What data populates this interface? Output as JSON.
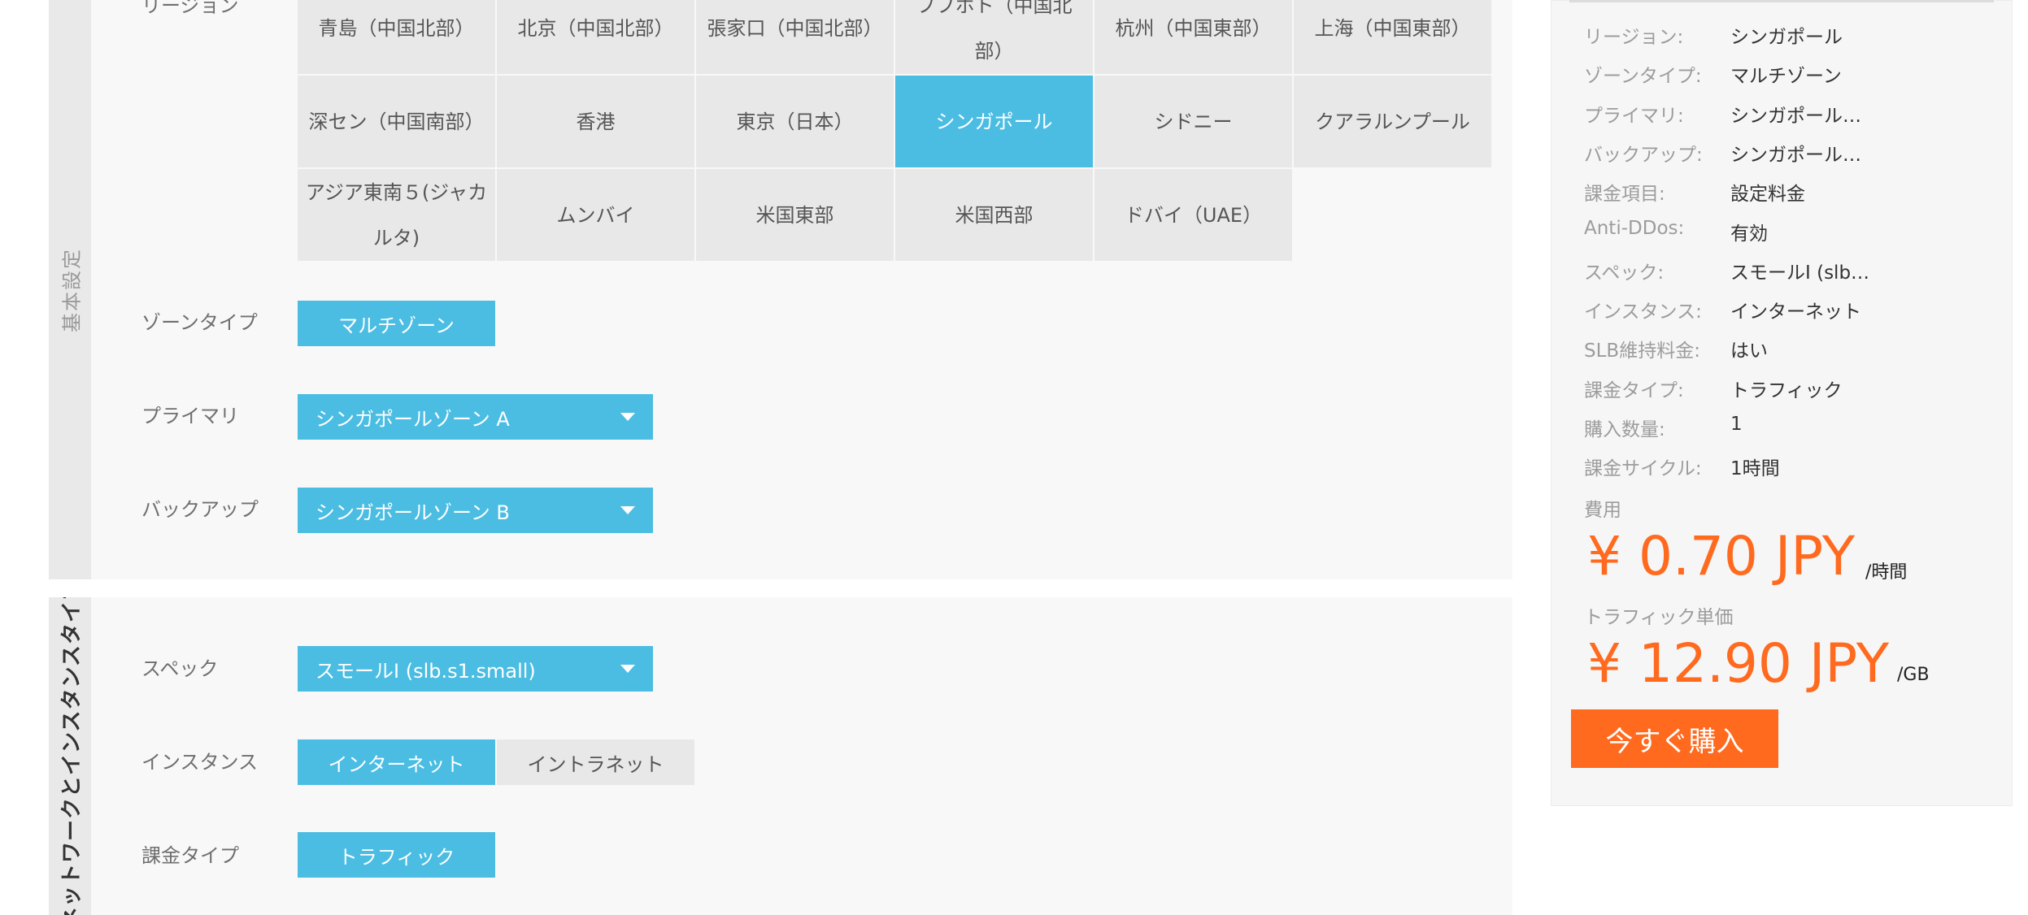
{
  "basic_settings": {
    "section_title": "基本設定",
    "region_label": "リージョン",
    "regions": [
      "青島（中国北部）",
      "北京（中国北部）",
      "張家口（中国北部）",
      "フフホト（中国北部）",
      "杭州（中国東部）",
      "上海（中国東部）",
      "深セン（中国南部）",
      "香港",
      "東京（日本）",
      "シンガポール",
      "シドニー",
      "クアラルンプール",
      "アジア東南５(ジャカルタ)",
      "ムンバイ",
      "米国東部",
      "米国西部",
      "ドバイ（UAE）"
    ],
    "selected_region": "シンガポール",
    "zone_type_label": "ゾーンタイプ",
    "zone_type_value": "マルチゾーン",
    "primary_label": "プライマリ",
    "primary_value": "シンガポールゾーン A",
    "backup_label": "バックアップ",
    "backup_value": "シンガポールゾーン B"
  },
  "network_instance": {
    "section_title": "ネットワークとインスタンスタイプ",
    "spec_label": "スペック",
    "spec_value": "スモールI (slb.s1.small)",
    "instance_label": "インスタンス",
    "instance_options": [
      "インターネット",
      "イントラネット"
    ],
    "instance_selected": "インターネット",
    "billing_type_label": "課金タイプ",
    "billing_type_value": "トラフィック"
  },
  "summary": {
    "rows": [
      {
        "label": "リージョン:",
        "value": "シンガポール"
      },
      {
        "label": "ゾーンタイプ:",
        "value": "マルチゾーン"
      },
      {
        "label": "プライマリ:",
        "value": "シンガポール…"
      },
      {
        "label": "バックアップ:",
        "value": "シンガポール…"
      },
      {
        "label": "課金項目:",
        "value": "設定料金"
      },
      {
        "label": "Anti-DDos:",
        "value": "有効"
      },
      {
        "label": "スペック:",
        "value": "スモールI (slb…"
      },
      {
        "label": "インスタンス:",
        "value": "インターネット"
      },
      {
        "label": "SLB維持料金:",
        "value": "はい"
      },
      {
        "label": "課金タイプ:",
        "value": "トラフィック"
      },
      {
        "label": "購入数量:",
        "value": "1"
      },
      {
        "label": "課金サイクル:",
        "value": "1時間"
      }
    ],
    "cost_label": "費用",
    "cost_value": "¥ 0.70 JPY",
    "cost_unit": "/時間",
    "traffic_label": "トラフィック単価",
    "traffic_value": "¥ 12.90 JPY",
    "traffic_unit": "/GB",
    "buy_label": "今すぐ購入"
  },
  "colors": {
    "accent_blue": "#4bbde3",
    "price_orange": "#ff6a1e",
    "cell_grey": "#e8e8e8",
    "section_bg": "#f8f8f8"
  }
}
